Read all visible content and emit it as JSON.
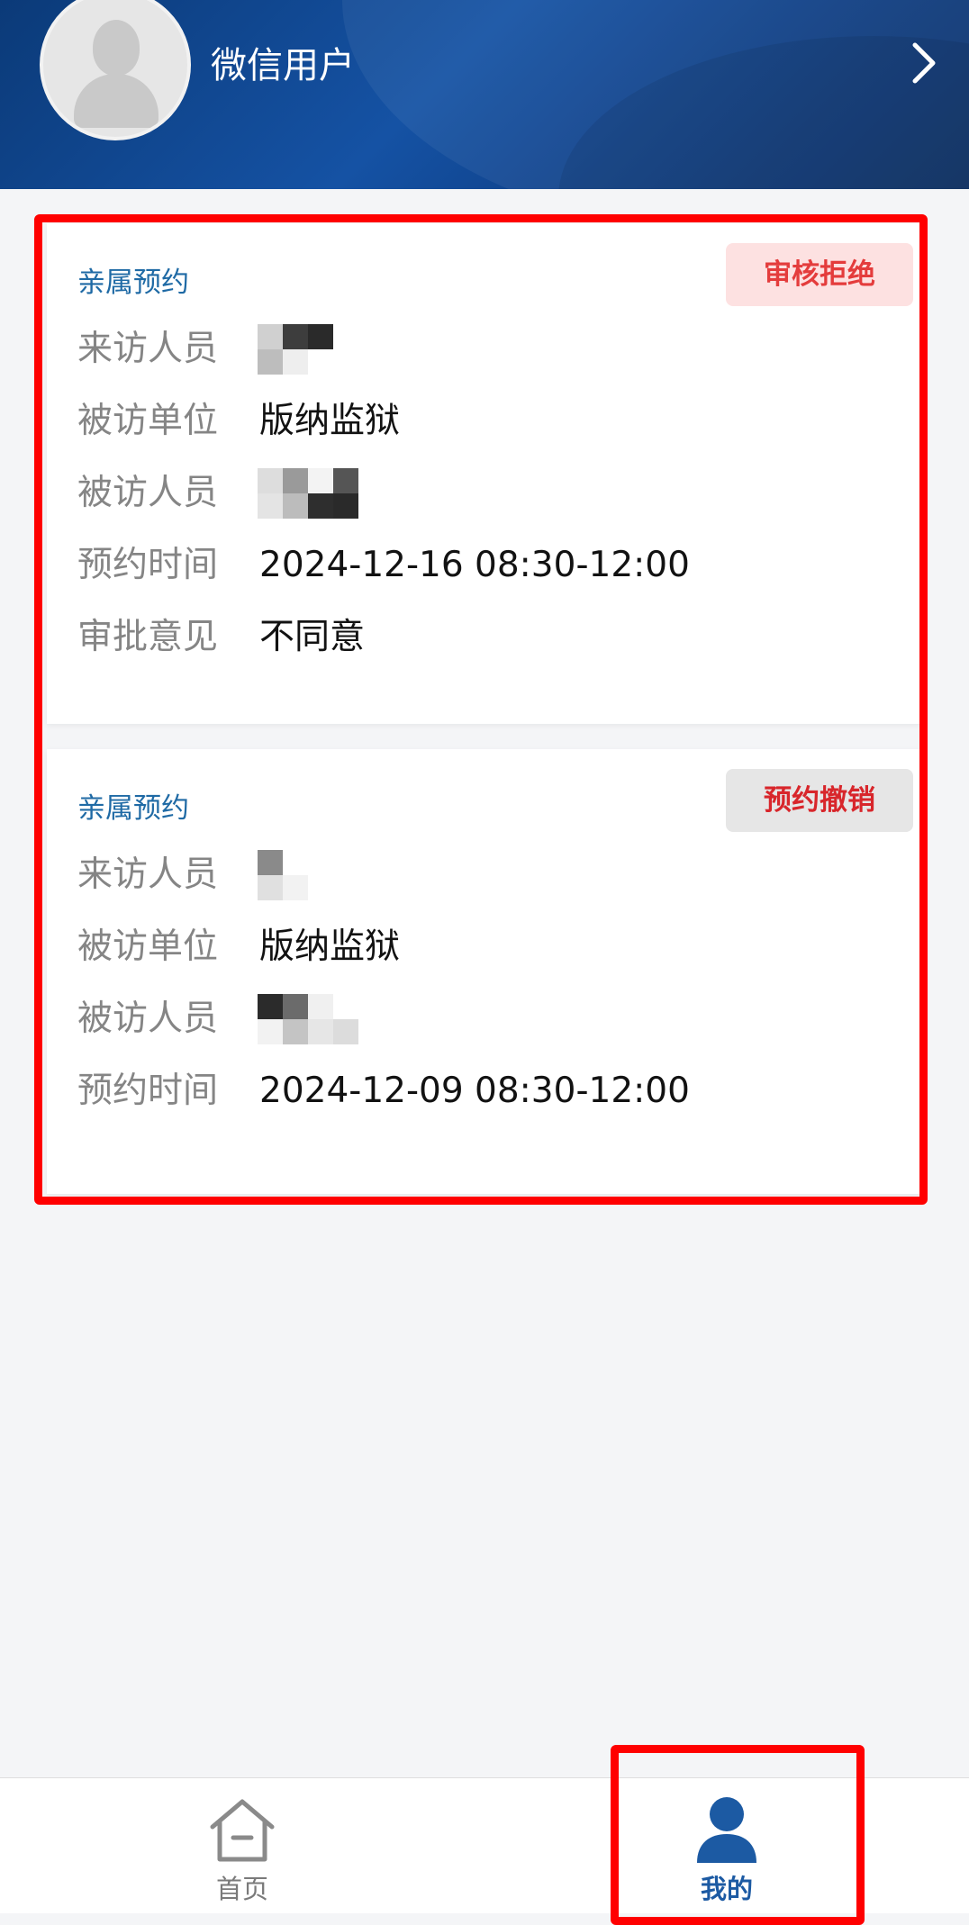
{
  "header": {
    "username": "微信用户"
  },
  "cards": [
    {
      "title": "亲属预约",
      "status": "审核拒绝",
      "rows": {
        "visitor_label": "来访人员",
        "unit_label": "被访单位",
        "unit_value": "版纳监狱",
        "visitee_label": "被访人员",
        "time_label": "预约时间",
        "time_value": "2024-12-16 08:30-12:00",
        "opinion_label": "审批意见",
        "opinion_value": "不同意"
      }
    },
    {
      "title": "亲属预约",
      "status": "预约撤销",
      "rows": {
        "visitor_label": "来访人员",
        "unit_label": "被访单位",
        "unit_value": "版纳监狱",
        "visitee_label": "被访人员",
        "time_label": "预约时间",
        "time_value": "2024-12-09 08:30-12:00"
      }
    }
  ],
  "tabbar": {
    "home_label": "首页",
    "mine_label": "我的",
    "active": "mine"
  },
  "colors": {
    "accent": "#1c5aa3",
    "reject_text": "#e43c3c",
    "highlight": "#ff0000"
  },
  "icons": [
    "user-avatar-icon",
    "chevron-right-icon",
    "home-icon",
    "person-icon"
  ]
}
